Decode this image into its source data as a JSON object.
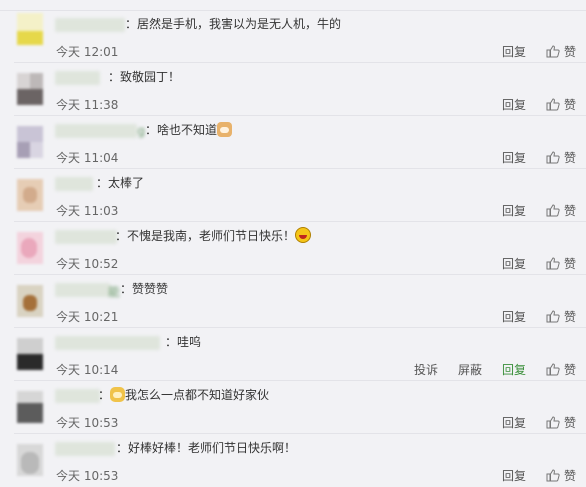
{
  "comments": [
    {
      "name_tail": "",
      "text": "：居然是手机，我害以为是无人机，牛的",
      "emoji": "",
      "text_after": "",
      "time": "今天 12:01"
    },
    {
      "name_tail": "",
      "text": "：致敬园丁！",
      "emoji": "",
      "text_after": "",
      "time": "今天 11:38"
    },
    {
      "name_tail": "g",
      "text": "：啥也不知道",
      "emoji": "cat-emoji",
      "text_after": "",
      "time": "今天 11:04"
    },
    {
      "name_tail": "",
      "text": "：太棒了",
      "emoji": "",
      "text_after": "",
      "time": "今天 11:03"
    },
    {
      "name_tail": "",
      "text": "：不愧是我南，老师们节日快乐！",
      "emoji": "laugh-emoji",
      "text_after": "",
      "time": "今天 10:52"
    },
    {
      "name_tail": "能",
      "text": "：赞赞赞",
      "emoji": "",
      "text_after": "",
      "time": "今天 10:21"
    },
    {
      "name_tail": "",
      "text": "：哇呜",
      "emoji": "",
      "text_after": "",
      "time": "今天 10:14"
    },
    {
      "name_tail": "",
      "text": "：",
      "emoji": "dog-emoji",
      "text_after": "我怎么一点都不知道好家伙",
      "time": "今天 10:53"
    },
    {
      "name_tail": "",
      "text": "：好棒好棒！老师们节日快乐啊！",
      "emoji": "",
      "text_after": "",
      "time": "今天 10:53"
    }
  ],
  "actions": {
    "report": "投诉",
    "block": "屏蔽",
    "reply": "回复",
    "like": "赞"
  },
  "colors": {
    "reply_active": "#3a8f3a",
    "name_blur": "#dfe5dc"
  }
}
